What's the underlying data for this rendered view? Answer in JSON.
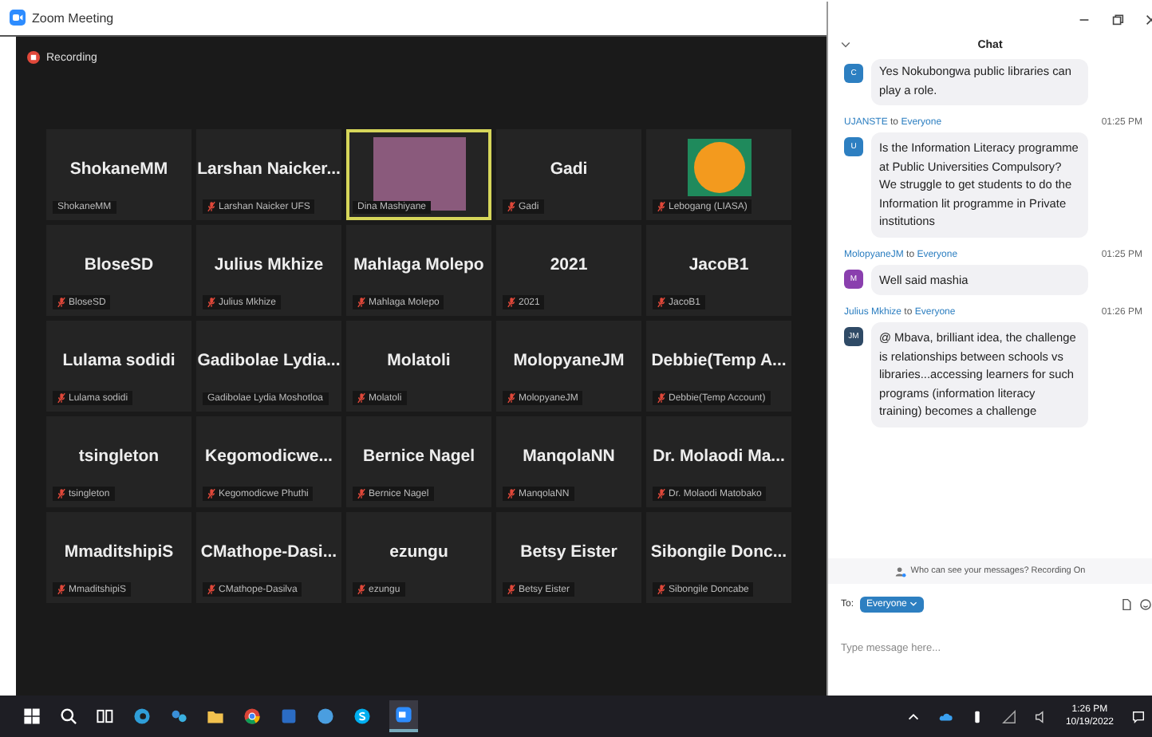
{
  "window": {
    "title": "Zoom Meeting"
  },
  "recording": {
    "label": "Recording"
  },
  "tiles": [
    {
      "kind": "name",
      "name": "ShokaneMM",
      "label": "ShokaneMM",
      "muted": false,
      "speaking": false
    },
    {
      "kind": "name",
      "name": "Larshan  Naicker...",
      "label": "Larshan Naicker UFS",
      "muted": true,
      "speaking": false
    },
    {
      "kind": "video",
      "label": "Dina Mashiyane",
      "muted": false,
      "speaking": true
    },
    {
      "kind": "name",
      "name": "Gadi",
      "label": "Gadi",
      "muted": true,
      "speaking": false
    },
    {
      "kind": "picture",
      "label": "Lebogang (LIASA)",
      "muted": true,
      "speaking": false
    },
    {
      "kind": "name",
      "name": "BloseSD",
      "label": "BloseSD",
      "muted": true,
      "speaking": false
    },
    {
      "kind": "name",
      "name": "Julius Mkhize",
      "label": "Julius Mkhize",
      "muted": true,
      "speaking": false
    },
    {
      "kind": "name",
      "name": "Mahlaga Molepo",
      "label": "Mahlaga Molepo",
      "muted": true,
      "speaking": false
    },
    {
      "kind": "name",
      "name": "2021",
      "label": "2021",
      "muted": true,
      "speaking": false
    },
    {
      "kind": "name",
      "name": "JacoB1",
      "label": "JacoB1",
      "muted": true,
      "speaking": false
    },
    {
      "kind": "name",
      "name": "Lulama sodidi",
      "label": "Lulama sodidi",
      "muted": true,
      "speaking": false
    },
    {
      "kind": "name",
      "name": "Gadibolae  Lydia...",
      "label": "Gadibolae Lydia Moshotloa",
      "muted": false,
      "speaking": false
    },
    {
      "kind": "name",
      "name": "Molatoli",
      "label": "Molatoli",
      "muted": true,
      "speaking": false
    },
    {
      "kind": "name",
      "name": "MolopyaneJM",
      "label": "MolopyaneJM",
      "muted": true,
      "speaking": false
    },
    {
      "kind": "name",
      "name": "Debbie(Temp  A...",
      "label": "Debbie(Temp Account)",
      "muted": true,
      "speaking": false
    },
    {
      "kind": "name",
      "name": "tsingleton",
      "label": "tsingleton",
      "muted": true,
      "speaking": false
    },
    {
      "kind": "name",
      "name": "Kegomodicwe...",
      "label": "Kegomodicwe Phuthi",
      "muted": true,
      "speaking": false
    },
    {
      "kind": "name",
      "name": "Bernice Nagel",
      "label": "Bernice Nagel",
      "muted": true,
      "speaking": false
    },
    {
      "kind": "name",
      "name": "ManqolaNN",
      "label": "ManqolaNN",
      "muted": true,
      "speaking": false
    },
    {
      "kind": "name",
      "name": "Dr. Molaodi  Ma...",
      "label": "Dr. Molaodi Matobako",
      "muted": true,
      "speaking": false
    },
    {
      "kind": "name",
      "name": "MmaditshipiS",
      "label": "MmaditshipiS",
      "muted": true,
      "speaking": false
    },
    {
      "kind": "name",
      "name": "CMathope-Dasi...",
      "label": "CMathope-Dasilva",
      "muted": true,
      "speaking": false
    },
    {
      "kind": "name",
      "name": "ezungu",
      "label": "ezungu",
      "muted": true,
      "speaking": false
    },
    {
      "kind": "name",
      "name": "Betsy Eister",
      "label": "Betsy Eister",
      "muted": true,
      "speaking": false
    },
    {
      "kind": "name",
      "name": "Sibongile  Donc...",
      "label": "Sibongile Doncabe",
      "muted": true,
      "speaking": false
    }
  ],
  "chat": {
    "title": "Chat",
    "messages": [
      {
        "initials": "C",
        "color": "#2d7fc1",
        "text": "Yes Nokubongwa public libraries can play a role."
      },
      {
        "sender": "UJANSTE",
        "to_word": "to",
        "recipient": "Everyone",
        "time": "01:25 PM",
        "initials": "U",
        "color": "#2d7fc1",
        "text": "Is the Information Literacy programme at Public Universities Compulsory?  We struggle to get students to do the Information lit programme in Private institutions"
      },
      {
        "sender": "MolopyaneJM",
        "to_word": "to",
        "recipient": "Everyone",
        "time": "01:25 PM",
        "initials": "M",
        "color": "#8a3fae",
        "text": "Well said mashia"
      },
      {
        "sender": "Julius Mkhize",
        "to_word": "to",
        "recipient": "Everyone",
        "time": "01:26 PM",
        "initials": "JM",
        "color": "#2f4a66",
        "text": "@ Mbava, brilliant idea, the challenge is relationships between schools vs libraries...accessing learners for such programs (information literacy training) becomes a challenge"
      }
    ],
    "notice": "Who can see your messages? Recording On",
    "to_label": "To:",
    "recipient": "Everyone",
    "placeholder": "Type message here..."
  },
  "taskbar": {
    "time": "1:26 PM",
    "date": "10/19/2022"
  }
}
